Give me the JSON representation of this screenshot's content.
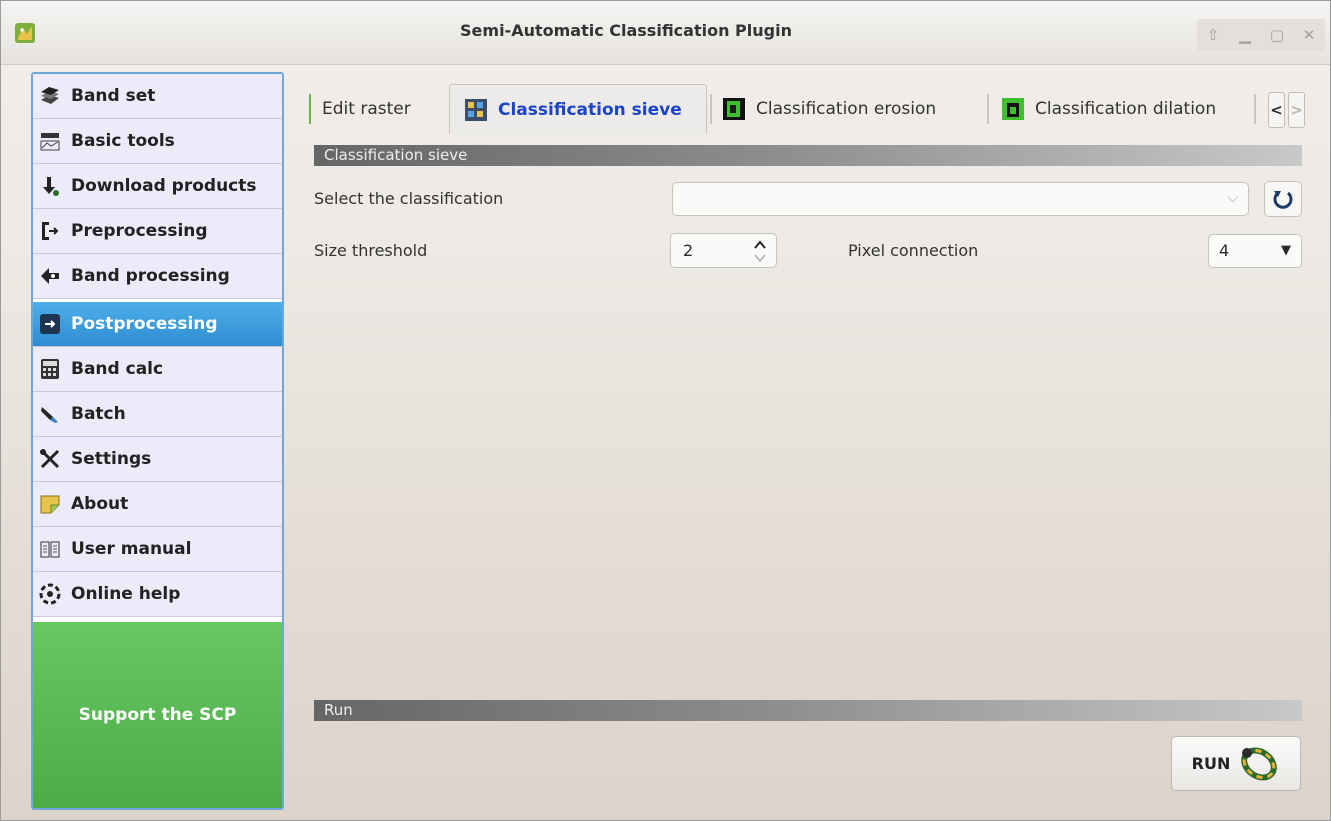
{
  "window": {
    "title": "Semi-Automatic Classification Plugin",
    "controls": [
      "up-arrow",
      "minimize",
      "maximize",
      "close"
    ]
  },
  "sidebar": {
    "items": [
      {
        "label": "Band set",
        "icon": "band-set-icon"
      },
      {
        "label": "Basic tools",
        "icon": "basic-tools-icon"
      },
      {
        "label": "Download products",
        "icon": "download-icon"
      },
      {
        "label": "Preprocessing",
        "icon": "preprocessing-icon"
      },
      {
        "label": "Band processing",
        "icon": "band-processing-icon"
      },
      {
        "label": "Postprocessing",
        "icon": "postprocessing-icon",
        "active": true
      },
      {
        "label": "Band calc",
        "icon": "calculator-icon"
      },
      {
        "label": "Batch",
        "icon": "batch-icon"
      },
      {
        "label": "Settings",
        "icon": "settings-icon"
      },
      {
        "label": "About",
        "icon": "about-icon"
      },
      {
        "label": "User manual",
        "icon": "manual-icon"
      },
      {
        "label": "Online help",
        "icon": "help-icon"
      }
    ],
    "support_label": "Support the SCP"
  },
  "tabs": [
    {
      "label": "Edit raster",
      "active": false
    },
    {
      "label": "Classification sieve",
      "active": true
    },
    {
      "label": "Classification erosion",
      "active": false
    },
    {
      "label": "Classification dilation",
      "active": false
    }
  ],
  "tab_scroll": {
    "left": "<",
    "right": ">"
  },
  "sieve": {
    "header": "Classification sieve",
    "select_label": "Select the classification",
    "select_value": "",
    "size_label": "Size threshold",
    "size_value": "2",
    "pixel_label": "Pixel connection",
    "pixel_value": "4"
  },
  "run": {
    "header": "Run",
    "button_label": "RUN"
  },
  "colors": {
    "accent_active": "#2f8dd1",
    "active_tab_text": "#1b44c8",
    "support_bg": "#4cab47"
  }
}
